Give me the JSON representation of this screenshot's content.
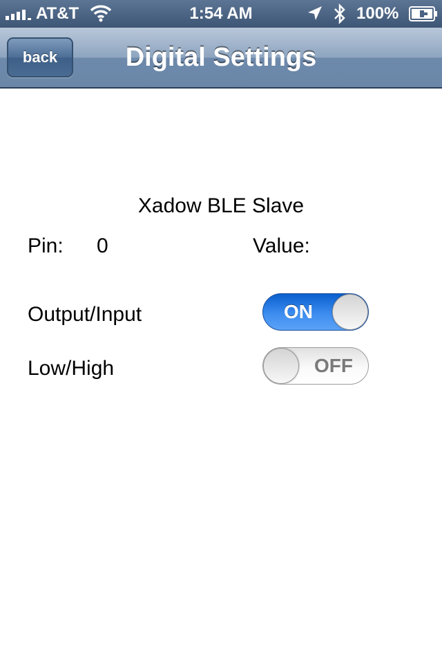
{
  "status_bar": {
    "carrier": "AT&T",
    "time": "1:54 AM",
    "battery": "100%",
    "icons": [
      "signal-icon",
      "wifi-icon",
      "location-icon",
      "bluetooth-icon",
      "battery-icon"
    ]
  },
  "nav": {
    "back_label": "back",
    "title": "Digital Settings"
  },
  "content": {
    "device_name": "Xadow BLE Slave",
    "pin_label": "Pin:",
    "pin_value": "0",
    "value_label": "Value:"
  },
  "switches": {
    "output_input": {
      "label": "Output/Input",
      "state_text": "ON",
      "on": true
    },
    "low_high": {
      "label": "Low/High",
      "state_text": "OFF",
      "on": false
    }
  },
  "colors": {
    "nav_accent": "#6b87a8",
    "switch_on": "#2f7fe6",
    "switch_off": "#f0f0f0"
  }
}
